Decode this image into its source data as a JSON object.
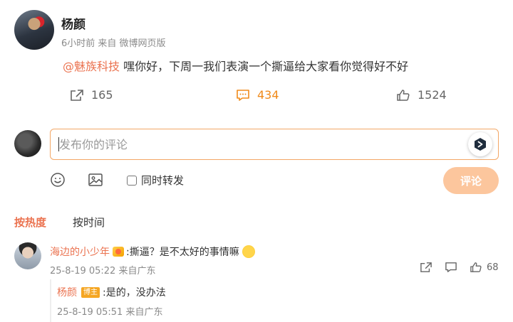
{
  "post": {
    "author": "杨颜",
    "meta": "6小时前 来自 微博网页版",
    "mention": "@魅族科技",
    "text": " 嘿你好，下周一我们表演一个撕逼给大家看你觉得好不好",
    "actions": {
      "forward_count": "165",
      "comment_count": "434",
      "like_count": "1524"
    }
  },
  "composer": {
    "placeholder": "发布你的评论",
    "repost_label": "同时转发",
    "submit_label": "评论"
  },
  "sort_tabs": {
    "hot": "按热度",
    "time": "按时间"
  },
  "comment": {
    "user": "海边的小少年",
    "text": ":撕逼？是不太好的事情嘛",
    "time": "25-8-19 05:22 来自广东",
    "like_count": "68"
  },
  "reply": {
    "user": "杨颜",
    "badge": "博主",
    "text": ":是的，没办法",
    "time": "25-8-19 05:51 来自广东"
  },
  "colors": {
    "accent": "#eb7350",
    "comment_active": "#f08a1a",
    "submit_bg": "#fcc69d",
    "composer_border": "#f3a766"
  }
}
